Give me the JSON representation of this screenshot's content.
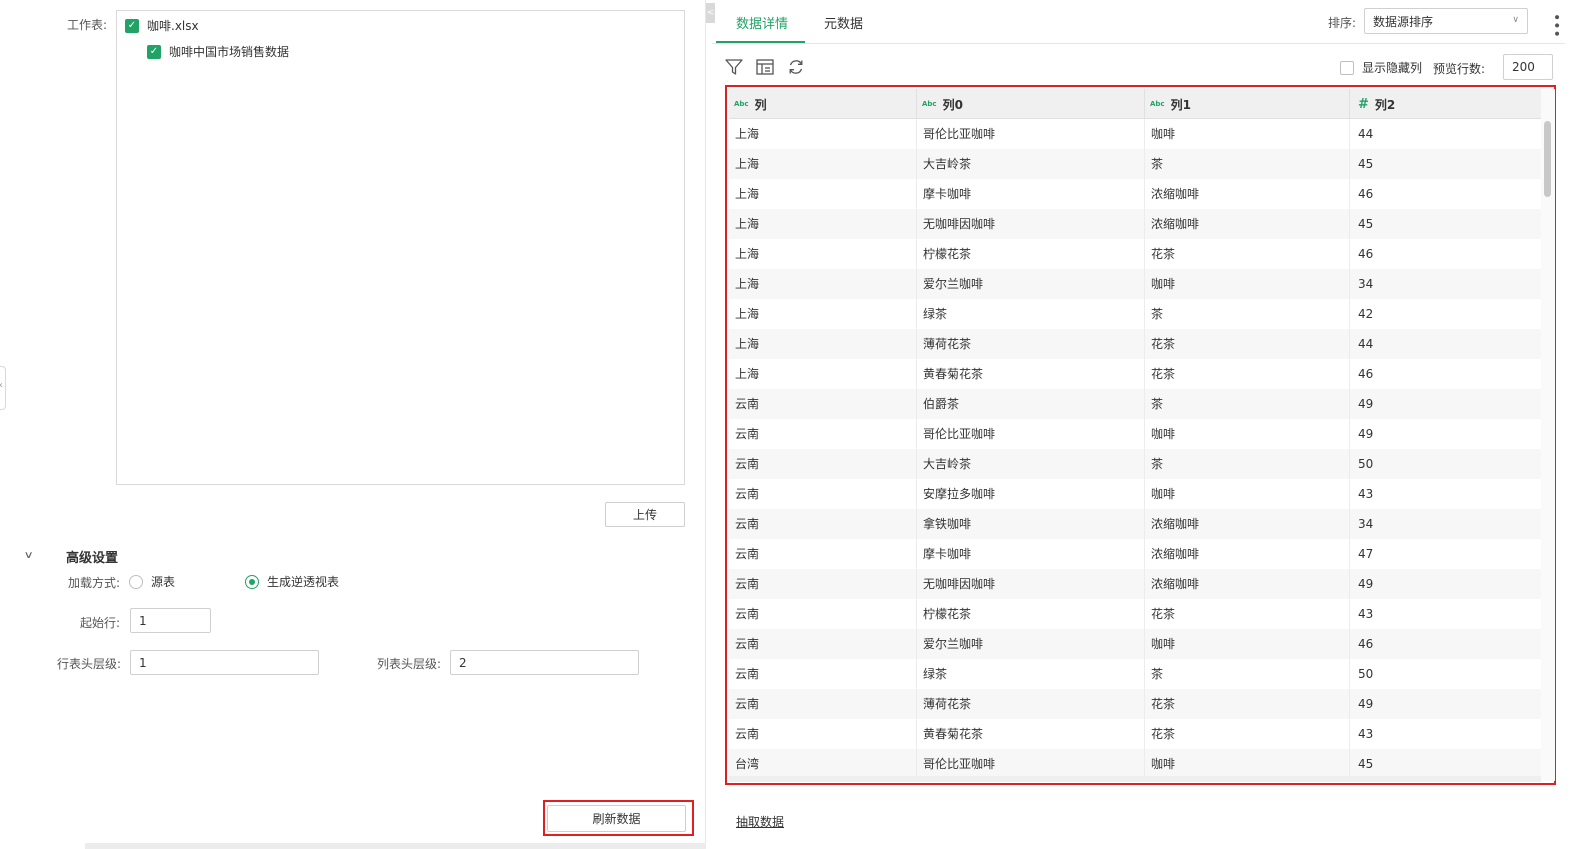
{
  "left": {
    "worksheet_label": "工作表:",
    "tree": [
      {
        "label": "咖啡.xlsx",
        "checked": true
      },
      {
        "label": "咖啡中国市场销售数据",
        "checked": true
      }
    ],
    "upload_button": "上传",
    "advanced_title": "高级设置",
    "load_mode_label": "加载方式:",
    "load_mode_options": [
      {
        "label": "源表",
        "selected": false
      },
      {
        "label": "生成逆透视表",
        "selected": true
      }
    ],
    "start_row_label": "起始行:",
    "start_row_value": "1",
    "row_header_label": "行表头层级:",
    "row_header_value": "1",
    "col_header_label": "列表头层级:",
    "col_header_value": "2",
    "refresh_button": "刷新数据"
  },
  "right": {
    "collapse_glyph": "<",
    "tabs": [
      {
        "label": "数据详情",
        "active": true
      },
      {
        "label": "元数据",
        "active": false
      }
    ],
    "sort_label": "排序:",
    "sort_value": "数据源排序",
    "toolbar_icons": [
      "filter-icon",
      "column-settings-icon",
      "refresh-icon"
    ],
    "show_hidden_label": "显示隐藏列",
    "show_hidden_checked": false,
    "preview_rows_label": "预览行数:",
    "preview_rows_value": "200",
    "extract_link": "抽取数据",
    "accent_color": "#21a366",
    "highlight_color": "#e02020"
  },
  "table": {
    "columns": [
      {
        "type_icon": "Abc",
        "name": "列"
      },
      {
        "type_icon": "Abc",
        "name": "列0"
      },
      {
        "type_icon": "Abc",
        "name": "列1"
      },
      {
        "type_icon": "#",
        "name": "列2"
      }
    ],
    "rows": [
      [
        "上海",
        "哥伦比亚咖啡",
        "咖啡",
        "44"
      ],
      [
        "上海",
        "大吉岭茶",
        "茶",
        "45"
      ],
      [
        "上海",
        "摩卡咖啡",
        "浓缩咖啡",
        "46"
      ],
      [
        "上海",
        "无咖啡因咖啡",
        "浓缩咖啡",
        "45"
      ],
      [
        "上海",
        "柠檬花茶",
        "花茶",
        "46"
      ],
      [
        "上海",
        "爱尔兰咖啡",
        "咖啡",
        "34"
      ],
      [
        "上海",
        "绿茶",
        "茶",
        "42"
      ],
      [
        "上海",
        "薄荷花茶",
        "花茶",
        "44"
      ],
      [
        "上海",
        "黄春菊花茶",
        "花茶",
        "46"
      ],
      [
        "云南",
        "伯爵茶",
        "茶",
        "49"
      ],
      [
        "云南",
        "哥伦比亚咖啡",
        "咖啡",
        "49"
      ],
      [
        "云南",
        "大吉岭茶",
        "茶",
        "50"
      ],
      [
        "云南",
        "安摩拉多咖啡",
        "咖啡",
        "43"
      ],
      [
        "云南",
        "拿铁咖啡",
        "浓缩咖啡",
        "34"
      ],
      [
        "云南",
        "摩卡咖啡",
        "浓缩咖啡",
        "47"
      ],
      [
        "云南",
        "无咖啡因咖啡",
        "浓缩咖啡",
        "49"
      ],
      [
        "云南",
        "柠檬花茶",
        "花茶",
        "43"
      ],
      [
        "云南",
        "爱尔兰咖啡",
        "咖啡",
        "46"
      ],
      [
        "云南",
        "绿茶",
        "茶",
        "50"
      ],
      [
        "云南",
        "薄荷花茶",
        "花茶",
        "49"
      ],
      [
        "云南",
        "黄春菊花茶",
        "花茶",
        "43"
      ],
      [
        "台湾",
        "哥伦比亚咖啡",
        "咖啡",
        "45"
      ]
    ]
  }
}
